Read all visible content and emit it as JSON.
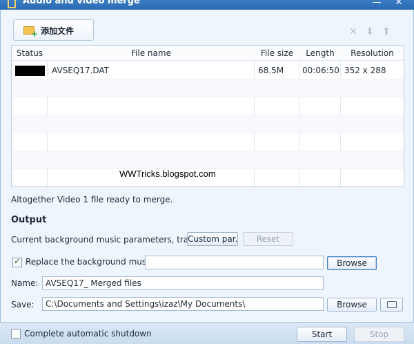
{
  "window": {
    "title": "Audio and video merge",
    "minimize_glyph": "—",
    "close_glyph": "✕"
  },
  "toolbar": {
    "add_file_label": "添加文件",
    "icons": [
      "delete-icon",
      "move-down-icon",
      "move-up-icon"
    ]
  },
  "table": {
    "headers": [
      "Status",
      "File name",
      "File size",
      "Length",
      "Resolution"
    ],
    "rows": [
      {
        "file_name": "AVSEQ17.DAT",
        "file_size": "68.5M",
        "length": "00:06:50",
        "resolution": "352 x 288"
      }
    ]
  },
  "watermark": "WWTricks.blogspot.com",
  "status_message": "Altogether Video 1 file ready to merge.",
  "output": {
    "title": "Output",
    "bg_music_label": "Current background music parameters, tran...",
    "custom_button": "Custom par...",
    "reset_button": "Reset",
    "replace_bg_label": "Replace the background music",
    "replace_bg_checked": true,
    "bg_music_value": "",
    "browse_button_1": "Browse",
    "name_label": "Name:",
    "name_value": "AVSEQ17_ Merged files",
    "save_label": "Save:",
    "save_value": "C:\\Documents and Settings\\izaz\\My Documents\\",
    "browse_button_2": "Browse"
  },
  "footer": {
    "shutdown_label": "Complete automatic shutdown",
    "shutdown_checked": false,
    "start_button": "Start",
    "stop_button": "Stop"
  },
  "colors": {
    "titlebar": "#2a6ab2",
    "panel_background": "#eef5fc",
    "footer_background": "#cadcf0"
  }
}
